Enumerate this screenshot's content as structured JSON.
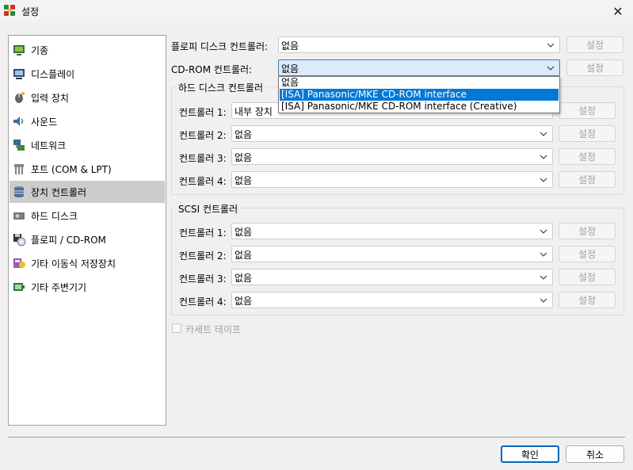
{
  "window": {
    "title": "설정",
    "icon": "app-icon",
    "close_icon": "✕"
  },
  "sidebar": {
    "items": [
      {
        "label": "기종",
        "icon": "machine-icon",
        "selected": false
      },
      {
        "label": "디스플레이",
        "icon": "display-icon",
        "selected": false
      },
      {
        "label": "입력 장치",
        "icon": "input-device-icon",
        "selected": false
      },
      {
        "label": "사운드",
        "icon": "sound-icon",
        "selected": false
      },
      {
        "label": "네트워크",
        "icon": "network-icon",
        "selected": false
      },
      {
        "label": "포트 (COM & LPT)",
        "icon": "ports-icon",
        "selected": false
      },
      {
        "label": "장치 컨트롤러",
        "icon": "storage-controller-icon",
        "selected": true
      },
      {
        "label": "하드 디스크",
        "icon": "hard-disk-icon",
        "selected": false
      },
      {
        "label": "플로피 / CD-ROM",
        "icon": "floppy-cdrom-icon",
        "selected": false
      },
      {
        "label": "기타 이동식 저장장치",
        "icon": "removable-storage-icon",
        "selected": false
      },
      {
        "label": "기타 주변기기",
        "icon": "peripherals-icon",
        "selected": false
      }
    ]
  },
  "floppy": {
    "label": "플로피 디스크 컨트롤러:",
    "value": "없음",
    "configure": "설정"
  },
  "cdrom": {
    "label": "CD-ROM 컨트롤러:",
    "value": "없음",
    "configure": "설정",
    "options": [
      "없음",
      "[ISA] Panasonic/MKE CD-ROM interface",
      "[ISA] Panasonic/MKE CD-ROM interface (Creative)"
    ],
    "highlighted_option": 1
  },
  "hdd_group": {
    "title": "하드 디스크 컨트롤러",
    "controllers": [
      {
        "label": "컨트롤러 1:",
        "value": "내부 장치",
        "configure": "설정"
      },
      {
        "label": "컨트롤러 2:",
        "value": "없음",
        "configure": "설정"
      },
      {
        "label": "컨트롤러 3:",
        "value": "없음",
        "configure": "설정"
      },
      {
        "label": "컨트롤러 4:",
        "value": "없음",
        "configure": "설정"
      }
    ]
  },
  "scsi_group": {
    "title": "SCSI 컨트롤러",
    "controllers": [
      {
        "label": "컨트롤러 1:",
        "value": "없음",
        "configure": "설정"
      },
      {
        "label": "컨트롤러 2:",
        "value": "없음",
        "configure": "설정"
      },
      {
        "label": "컨트롤러 3:",
        "value": "없음",
        "configure": "설정"
      },
      {
        "label": "컨트롤러 4:",
        "value": "없음",
        "configure": "설정"
      }
    ]
  },
  "cassette": {
    "label": "카세트 테이프",
    "checked": false
  },
  "footer": {
    "ok": "확인",
    "cancel": "취소"
  },
  "colors": {
    "highlight": "#0078d7",
    "default_button_border": "#0067c0",
    "selected_item": "#cccccc"
  }
}
